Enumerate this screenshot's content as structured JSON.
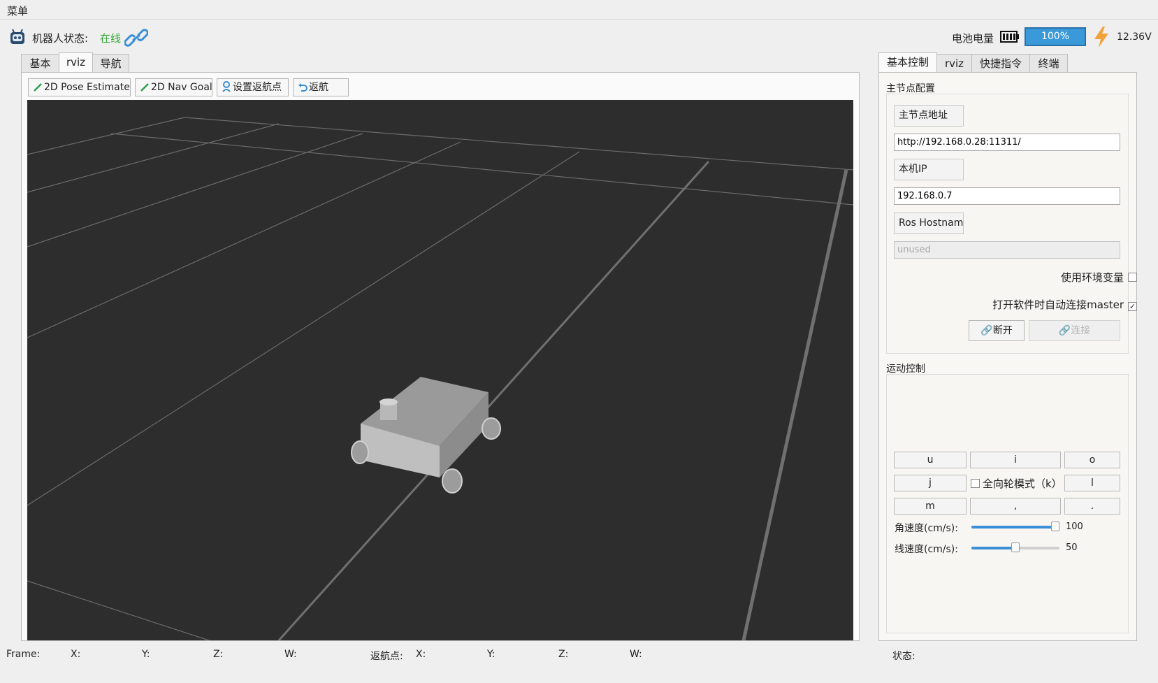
{
  "menu": {
    "label": "菜单"
  },
  "status": {
    "robot_label": "机器人状态:",
    "robot_value": "在线"
  },
  "battery": {
    "label": "电池电量",
    "percent_text": "100%",
    "level": 1.0,
    "voltage": "12.36V"
  },
  "left_tabs": [
    "基本",
    "rviz",
    "导航"
  ],
  "toolbar": {
    "pose_estimate": "2D Pose Estimate",
    "nav_goal": "2D Nav Goal",
    "set_return": "设置返航点",
    "return": "返航"
  },
  "right_tabs": [
    "基本控制",
    "rviz",
    "快捷指令",
    "终端"
  ],
  "master": {
    "title": "主节点配置",
    "addr_label": "主节点地址",
    "addr_value": "http://192.168.0.28:11311/",
    "ip_label": "本机IP",
    "ip_value": "192.168.0.7",
    "hostname_label": "Ros Hostname",
    "hostname_value": "unused",
    "use_env_label": "使用环境变量",
    "use_env_checked": false,
    "auto_connect_label": "打开软件时自动连接master",
    "auto_connect_checked": true,
    "disconnect_label": "断开",
    "connect_label": "连接"
  },
  "motion": {
    "title": "运动控制",
    "keys_row1": [
      "u",
      "i",
      "o"
    ],
    "keys_row2_left": "j",
    "keys_row2_right": "l",
    "omni_label": "全向轮模式（k）",
    "keys_row3": [
      "m",
      ",",
      "."
    ],
    "angular_label": "角速度(cm/s):",
    "angular_value": "100",
    "angular_level": 1.0,
    "linear_label": "线速度(cm/s):",
    "linear_value": "50",
    "linear_level": 0.5
  },
  "footer": {
    "frame": "Frame:",
    "x": "X:",
    "y": "Y:",
    "z": "Z:",
    "w": "W:",
    "return_point": "返航点:",
    "rx": "X:",
    "ry": "Y:",
    "rz": "Z:",
    "rw": "W:",
    "state": "状态:"
  },
  "colors": {
    "online": "#3aa83a",
    "battery": "#3a9ad9",
    "viewport": "#2d2d2d",
    "bolt": "#f2a23a"
  }
}
